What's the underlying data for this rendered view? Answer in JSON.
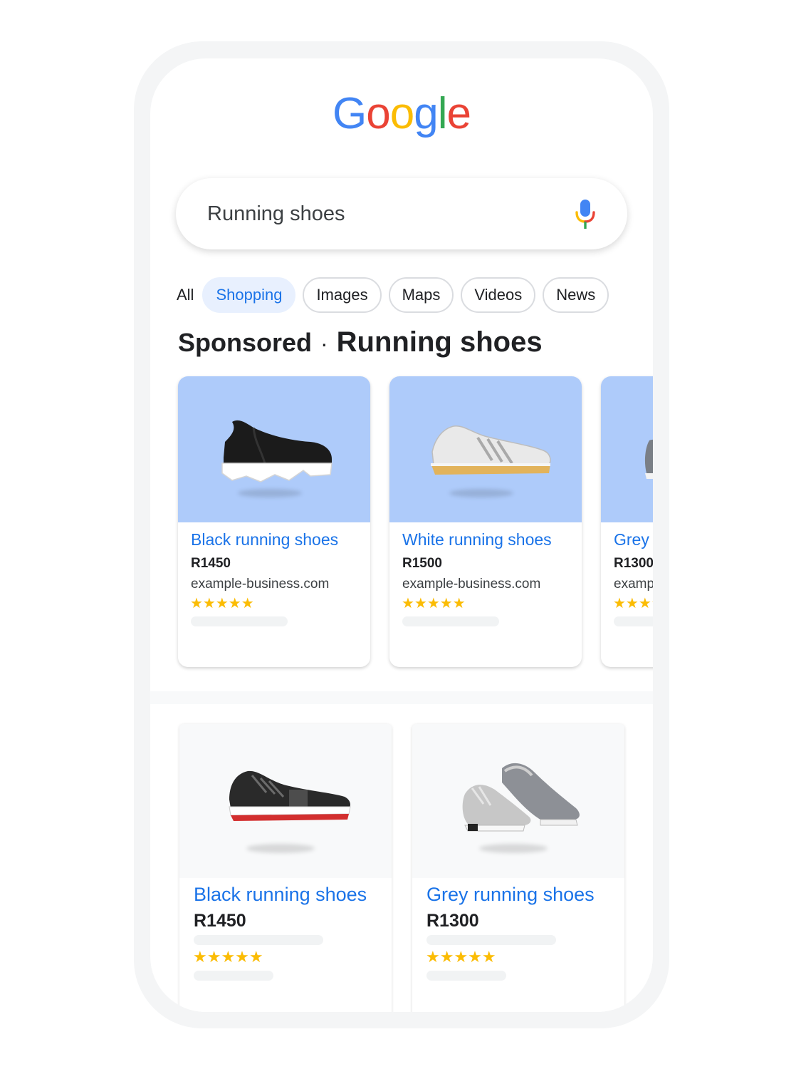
{
  "logo": {
    "letters": [
      "G",
      "o",
      "o",
      "g",
      "l",
      "e"
    ],
    "colors": [
      "#4285f4",
      "#ea4335",
      "#fbbc04",
      "#4285f4",
      "#34a853",
      "#ea4335"
    ]
  },
  "search": {
    "query": "Running shoes",
    "mic_icon": "mic-icon"
  },
  "tabs": {
    "all": "All",
    "items": [
      "Shopping",
      "Images",
      "Maps",
      "Videos",
      "News"
    ],
    "active": "Shopping"
  },
  "heading": {
    "sponsored": "Sponsored",
    "separator": "·",
    "query": "Running shoes"
  },
  "sponsored_cards": [
    {
      "title": "Black running shoes",
      "price": "R1450",
      "domain": "example-business.com",
      "stars": "★★★★★",
      "rating": 4.5
    },
    {
      "title": "White running shoes",
      "price": "R1500",
      "domain": "example-business.com",
      "stars": "★★★★★",
      "rating": 4.5
    },
    {
      "title": "Grey running shoes",
      "price": "R1300",
      "domain": "example-business.com",
      "stars": "★★★★★",
      "rating": 4.5
    }
  ],
  "grid_cards": [
    {
      "title": "Black running shoes",
      "price": "R1450",
      "stars": "★★★★★",
      "rating": 4.5
    },
    {
      "title": "Grey running shoes",
      "price": "R1300",
      "stars": "★★★★★",
      "rating": 4.5
    }
  ],
  "colors": {
    "accent": "#1a73e8",
    "chip_active_bg": "#e8f0fe",
    "card_image_bg": "#aecbfa",
    "star": "#fbbc04"
  }
}
